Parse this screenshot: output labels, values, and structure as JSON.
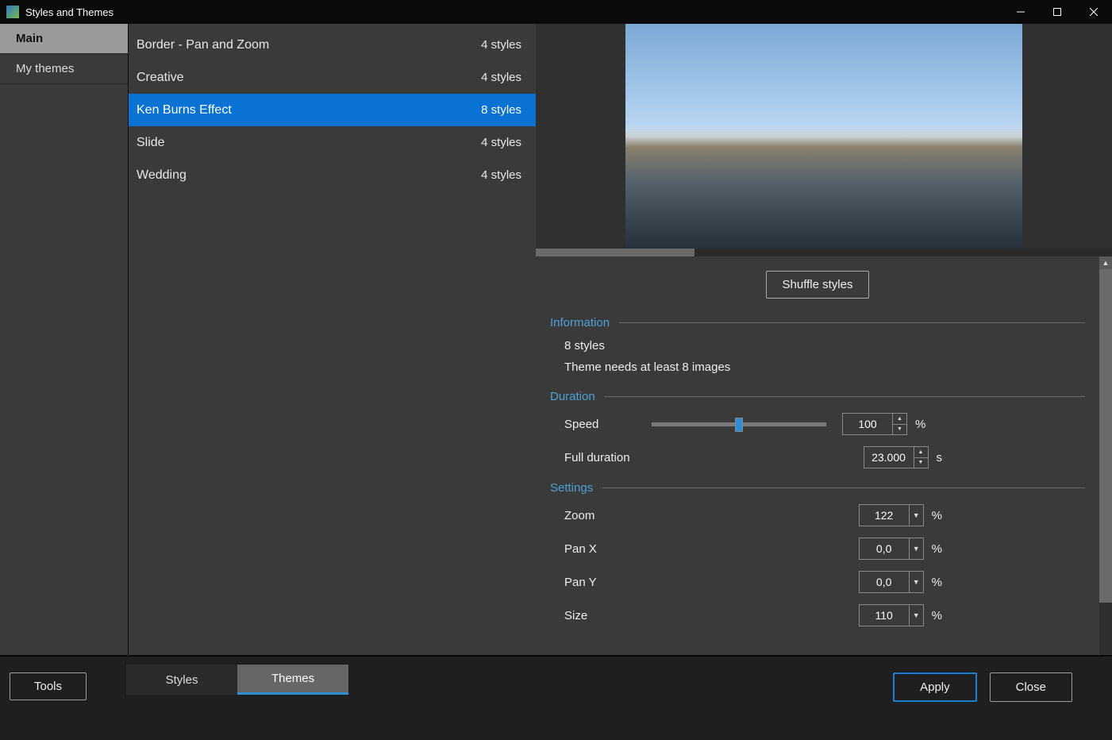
{
  "window": {
    "title": "Styles and Themes"
  },
  "sidebar": {
    "items": [
      {
        "label": "Main",
        "selected": true
      },
      {
        "label": "My themes",
        "selected": false
      }
    ]
  },
  "themes": [
    {
      "name": "Border - Pan and Zoom",
      "count": "4 styles",
      "selected": false
    },
    {
      "name": "Creative",
      "count": "4 styles",
      "selected": false
    },
    {
      "name": "Ken Burns Effect",
      "count": "8 styles",
      "selected": true
    },
    {
      "name": "Slide",
      "count": "4 styles",
      "selected": false
    },
    {
      "name": "Wedding",
      "count": "4 styles",
      "selected": false
    }
  ],
  "shuffle_label": "Shuffle styles",
  "sections": {
    "information": {
      "title": "Information",
      "line1": "8 styles",
      "line2": "Theme needs at least 8 images"
    },
    "duration": {
      "title": "Duration",
      "speed_label": "Speed",
      "speed_value": "100",
      "speed_unit": "%",
      "full_label": "Full duration",
      "full_value": "23.000",
      "full_unit": "s"
    },
    "settings": {
      "title": "Settings",
      "zoom_label": "Zoom",
      "zoom_value": "122",
      "zoom_unit": "%",
      "panx_label": "Pan X",
      "panx_value": "0,0",
      "panx_unit": "%",
      "pany_label": "Pan Y",
      "pany_value": "0,0",
      "pany_unit": "%",
      "size_label": "Size",
      "size_value": "110",
      "size_unit": "%"
    }
  },
  "footer": {
    "tools": "Tools",
    "tabs": [
      {
        "label": "Styles",
        "selected": false
      },
      {
        "label": "Themes",
        "selected": true
      }
    ],
    "apply": "Apply",
    "close": "Close"
  }
}
